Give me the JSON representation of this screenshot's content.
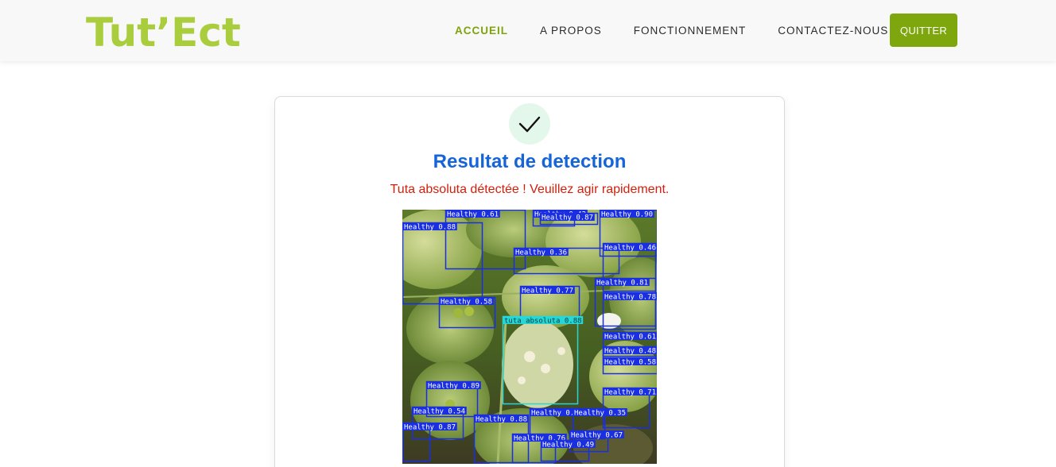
{
  "nav": {
    "brand": "Tut’Ect",
    "links": [
      {
        "label": "ACCUEIL",
        "active": true
      },
      {
        "label": "A PROPOS",
        "active": false
      },
      {
        "label": "FONCTIONNEMENT",
        "active": false
      },
      {
        "label": "CONTACTEZ-NOUS",
        "active": false
      }
    ],
    "quit_label": "QUITTER"
  },
  "result": {
    "title": "Resultat de detection",
    "alert": "Tuta absoluta détectée ! Veuillez agir rapidement."
  },
  "detections": [
    {
      "label": "Healthy 0.61"
    },
    {
      "label": "Healthy 0.42"
    },
    {
      "label": "Healthy 0.87"
    },
    {
      "label": "Healthy 0.90"
    },
    {
      "label": "Healthy 0.88"
    },
    {
      "label": "Healthy 0.36"
    },
    {
      "label": "Healthy 0.46"
    },
    {
      "label": "Healthy 0.81"
    },
    {
      "label": "Healthy 0.77"
    },
    {
      "label": "Healthy 0.78"
    },
    {
      "label": "Healthy 0.58"
    },
    {
      "label": "tuta absoluta 0.88"
    },
    {
      "label": "Healthy 0.61"
    },
    {
      "label": "Healthy 0.48"
    },
    {
      "label": "Healthy 0.58"
    },
    {
      "label": "Healthy 0.89"
    },
    {
      "label": "Healthy 0.71"
    },
    {
      "label": "Healthy 0.54"
    },
    {
      "label": "Healthy 0.88"
    },
    {
      "label": "Healthy 0.76"
    },
    {
      "label": "Healthy 0.35"
    },
    {
      "label": "Healthy 0.87"
    },
    {
      "label": "Healthy 0.67"
    },
    {
      "label": "Healthy 0.76"
    },
    {
      "label": "Healthy 0.49"
    }
  ],
  "colors": {
    "brand": "#a9cd3c",
    "accent": "#7ea60d",
    "title": "#1565d8",
    "alert": "#d21f0c",
    "box_healthy": "#1a2fe0",
    "box_tuta": "#27d6d6"
  },
  "icons": {
    "success": "check-icon"
  }
}
